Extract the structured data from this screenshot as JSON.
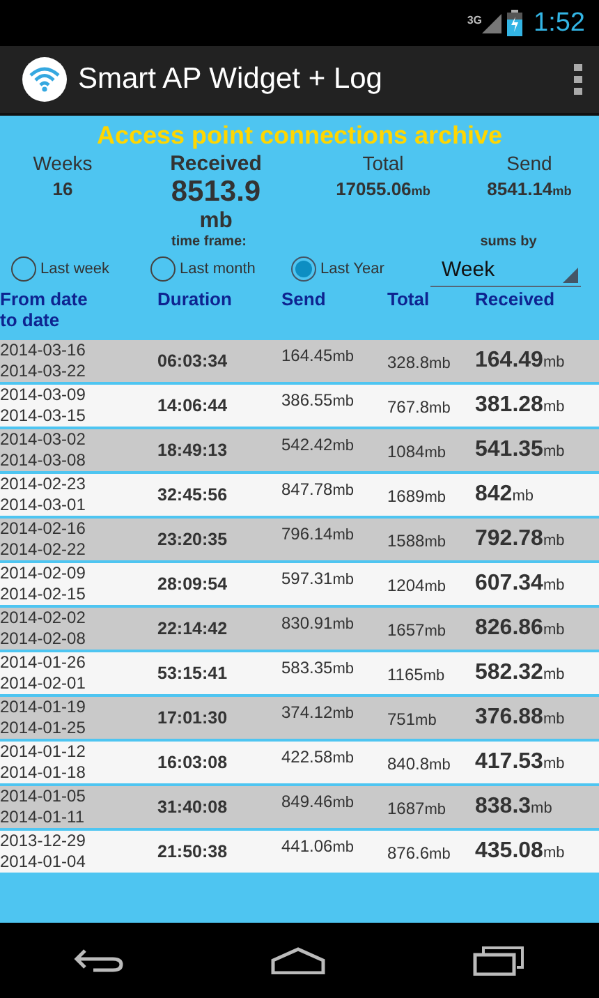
{
  "status_bar": {
    "network": "3G",
    "time": "1:52"
  },
  "action_bar": {
    "title": "Smart AP Widget + Log"
  },
  "archive_title": "Access point connections archive",
  "summary": [
    {
      "label": "Weeks",
      "value": "16",
      "kind": "plain"
    },
    {
      "label": "Received",
      "value": "8513.9",
      "unit": "mb",
      "kind": "main"
    },
    {
      "label": "Total",
      "value": "17055.06",
      "unit": "mb",
      "kind": "plain"
    },
    {
      "label": "Send",
      "value": "8541.14",
      "unit": "mb",
      "kind": "plain"
    }
  ],
  "time_frame_label": "time frame:",
  "sums_by_label": "sums by",
  "time_frames": [
    {
      "label": "Last week",
      "selected": false
    },
    {
      "label": "Last month",
      "selected": false
    },
    {
      "label": "Last Year",
      "selected": true
    }
  ],
  "sums_by": {
    "value": "Week"
  },
  "table": {
    "columns": [
      "From date\nto date",
      "Duration",
      "Send",
      "Total",
      "Received"
    ],
    "rows": [
      {
        "from": "2014-03-16",
        "to": "2014-03-22",
        "duration": "06:03:34",
        "send": {
          "value": "164.45",
          "unit": "mb"
        },
        "total": {
          "value": "328.8",
          "unit": "mb"
        },
        "received": {
          "value": "164.49",
          "unit": "mb"
        }
      },
      {
        "from": "2014-03-09",
        "to": "2014-03-15",
        "duration": "14:06:44",
        "send": {
          "value": "386.55",
          "unit": "mb"
        },
        "total": {
          "value": "767.8",
          "unit": "mb"
        },
        "received": {
          "value": "381.28",
          "unit": "mb"
        }
      },
      {
        "from": "2014-03-02",
        "to": "2014-03-08",
        "duration": "18:49:13",
        "send": {
          "value": "542.42",
          "unit": "mb"
        },
        "total": {
          "value": "1084",
          "unit": "mb"
        },
        "received": {
          "value": "541.35",
          "unit": "mb"
        }
      },
      {
        "from": "2014-02-23",
        "to": "2014-03-01",
        "duration": "32:45:56",
        "send": {
          "value": "847.78",
          "unit": "mb"
        },
        "total": {
          "value": "1689",
          "unit": "mb"
        },
        "received": {
          "value": "842",
          "unit": "mb"
        }
      },
      {
        "from": "2014-02-16",
        "to": "2014-02-22",
        "duration": "23:20:35",
        "send": {
          "value": "796.14",
          "unit": "mb"
        },
        "total": {
          "value": "1588",
          "unit": "mb"
        },
        "received": {
          "value": "792.78",
          "unit": "mb"
        }
      },
      {
        "from": "2014-02-09",
        "to": "2014-02-15",
        "duration": "28:09:54",
        "send": {
          "value": "597.31",
          "unit": "mb"
        },
        "total": {
          "value": "1204",
          "unit": "mb"
        },
        "received": {
          "value": "607.34",
          "unit": "mb"
        }
      },
      {
        "from": "2014-02-02",
        "to": "2014-02-08",
        "duration": "22:14:42",
        "send": {
          "value": "830.91",
          "unit": "mb"
        },
        "total": {
          "value": "1657",
          "unit": "mb"
        },
        "received": {
          "value": "826.86",
          "unit": "mb"
        }
      },
      {
        "from": "2014-01-26",
        "to": "2014-02-01",
        "duration": "53:15:41",
        "send": {
          "value": "583.35",
          "unit": "mb"
        },
        "total": {
          "value": "1165",
          "unit": "mb"
        },
        "received": {
          "value": "582.32",
          "unit": "mb"
        }
      },
      {
        "from": "2014-01-19",
        "to": "2014-01-25",
        "duration": "17:01:30",
        "send": {
          "value": "374.12",
          "unit": "mb"
        },
        "total": {
          "value": "751",
          "unit": "mb"
        },
        "received": {
          "value": "376.88",
          "unit": "mb"
        }
      },
      {
        "from": "2014-01-12",
        "to": "2014-01-18",
        "duration": "16:03:08",
        "send": {
          "value": "422.58",
          "unit": "mb"
        },
        "total": {
          "value": "840.8",
          "unit": "mb"
        },
        "received": {
          "value": "417.53",
          "unit": "mb"
        }
      },
      {
        "from": "2014-01-05",
        "to": "2014-01-11",
        "duration": "31:40:08",
        "send": {
          "value": "849.46",
          "unit": "mb"
        },
        "total": {
          "value": "1687",
          "unit": "mb"
        },
        "received": {
          "value": "838.3",
          "unit": "mb"
        }
      },
      {
        "from": "2013-12-29",
        "to": "2014-01-04",
        "duration": "21:50:38",
        "send": {
          "value": "441.06",
          "unit": "mb"
        },
        "total": {
          "value": "876.6",
          "unit": "mb"
        },
        "received": {
          "value": "435.08",
          "unit": "mb"
        }
      }
    ]
  }
}
